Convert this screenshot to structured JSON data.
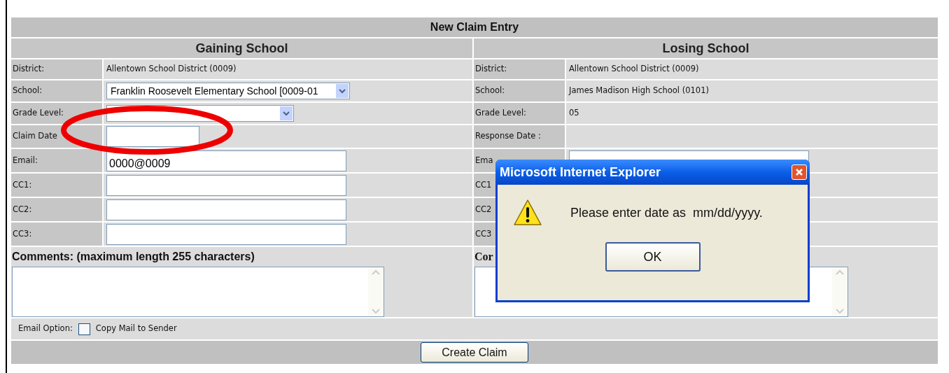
{
  "title": "New Claim Entry",
  "gaining": {
    "heading": "Gaining School",
    "rows": [
      {
        "kind": "text",
        "label": "District:",
        "value": "Allentown School District (0009)"
      },
      {
        "kind": "wide_select",
        "label": "School:",
        "value": "Franklin Roosevelt Elementary School [0009-01"
      },
      {
        "kind": "select",
        "label": "Grade Level:"
      },
      {
        "kind": "short_input",
        "label": "Claim Date"
      },
      {
        "kind": "input",
        "label": "Email:",
        "value": "0000@0009"
      },
      {
        "kind": "input",
        "label": "CC1:"
      },
      {
        "kind": "input",
        "label": "CC2:"
      },
      {
        "kind": "input",
        "label": "CC3:"
      }
    ],
    "comments_label": "Comments: (maximum length 255 characters)"
  },
  "losing": {
    "heading": "Losing School",
    "rows": [
      {
        "kind": "text",
        "label": "District:",
        "value": "Allentown School District (0009)"
      },
      {
        "kind": "text",
        "label": "School:",
        "value": "James Madison High School (0101)"
      },
      {
        "kind": "text",
        "label": "Grade Level:",
        "value": "05"
      },
      {
        "kind": "text",
        "label": "Response Date :"
      },
      {
        "kind": "input",
        "label": "Ema"
      },
      {
        "kind": "text",
        "label": "CC1"
      },
      {
        "kind": "text",
        "label": "CC2"
      },
      {
        "kind": "text",
        "label": "CC3"
      }
    ],
    "comments_label": "Cor"
  },
  "email_option": {
    "label": "Email Option:",
    "checkbox": {
      "label": "Copy Mail to Sender",
      "checked": false
    }
  },
  "submit": "Create Claim",
  "dialog": {
    "title": "Microsoft Internet Explorer",
    "message": "Please enter date as  mm/dd/yyyy.",
    "button": "OK"
  }
}
